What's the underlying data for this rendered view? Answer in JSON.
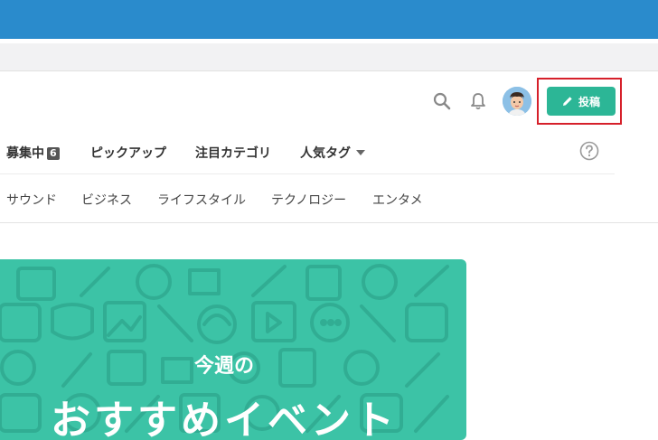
{
  "header": {
    "post_button_label": "投稿",
    "accent_color": "#2cb696",
    "highlight_color": "#d6202a"
  },
  "nav_primary": {
    "recruiting_label": "募集中",
    "recruiting_count": "6",
    "pickup_label": "ピックアップ",
    "featured_category_label": "注目カテゴリ",
    "popular_tags_label": "人気タグ"
  },
  "nav_secondary": {
    "items": [
      "サウンド",
      "ビジネス",
      "ライフスタイル",
      "テクノロジー",
      "エンタメ"
    ]
  },
  "banner": {
    "subtitle": "今週の",
    "title": "おすすめイベント",
    "color": "#3cc3a6"
  },
  "icons": [
    "search-icon",
    "bell-icon",
    "pencil-icon",
    "help-icon",
    "chevron-down-icon"
  ]
}
